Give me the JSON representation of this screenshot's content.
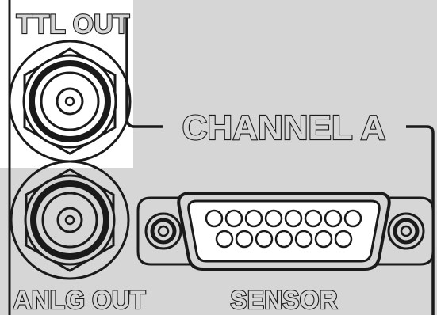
{
  "labels": {
    "ttl_out": "TTL OUT",
    "channel": "CHANNEL A",
    "anlg_out": "ANLG OUT",
    "sensor": "SENSOR"
  },
  "colors": {
    "panel": "#d6d6d6",
    "highlight": "#ffffff",
    "ink": "#1a1a1a"
  },
  "connectors": {
    "ttl_out": "bnc-connector",
    "anlg_out": "bnc-connector",
    "sensor": "db15-connector",
    "sensor_pin_rows": [
      8,
      7
    ]
  }
}
